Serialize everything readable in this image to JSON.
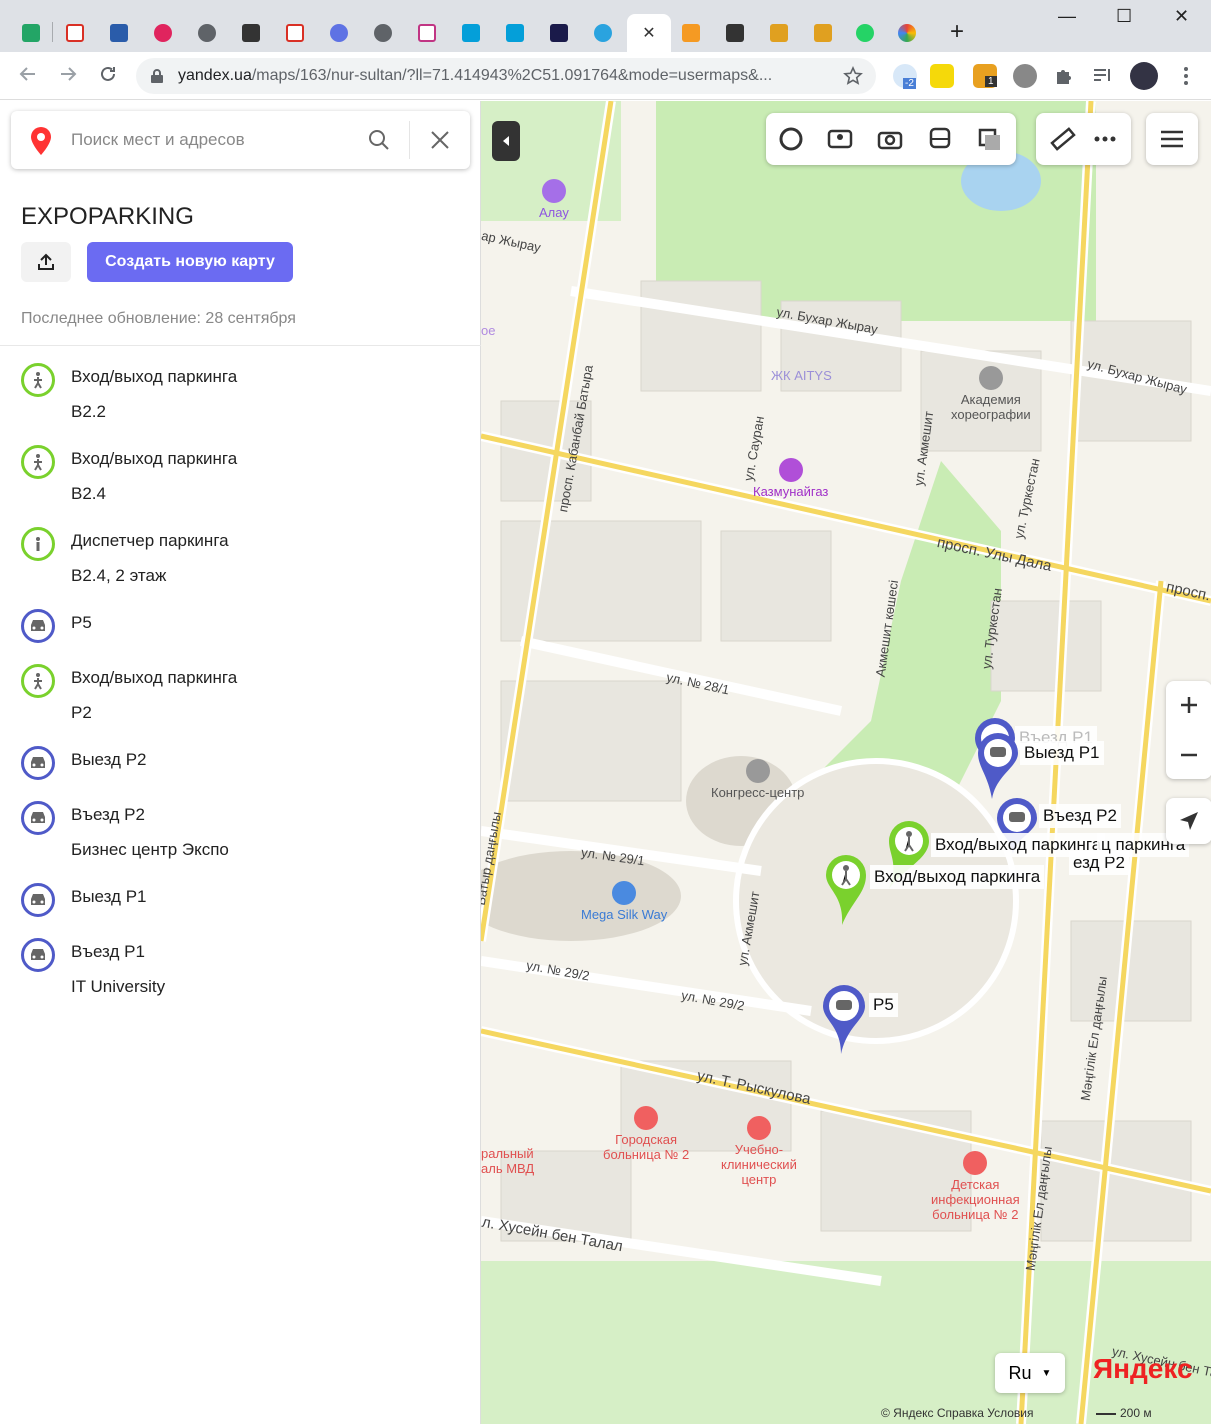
{
  "browser": {
    "url_host": "yandex.ua",
    "url_rest": "/maps/163/nur-sultan/?ll=71.414943%2C51.091764&mode=usermaps&...",
    "ext_badge_2": "-2",
    "ext_badge_1": "1",
    "new_tab": "+",
    "minimize": "—",
    "maximize": "☐",
    "close": "✕",
    "tab_close": "✕"
  },
  "sidebar": {
    "search_placeholder": "Поиск мест и адресов",
    "title": "EXPOPARKING",
    "create_label": "Создать новую карту",
    "updated": "Последнее обновление: 28 сентября",
    "items": [
      {
        "icon": "pedestrian-icon",
        "kind": "green",
        "line1": "Вход/выход паркинга",
        "line2": "B2.2"
      },
      {
        "icon": "pedestrian-icon",
        "kind": "green",
        "line1": "Вход/выход паркинга",
        "line2": "B2.4"
      },
      {
        "icon": "info-icon",
        "kind": "green",
        "line1": "Диспетчер паркинга",
        "line2": "B2.4, 2 этаж"
      },
      {
        "icon": "car-icon",
        "kind": "blue",
        "line1": "P5",
        "line2": ""
      },
      {
        "icon": "pedestrian-icon",
        "kind": "green",
        "line1": "Вход/выход паркинга",
        "line2": "P2"
      },
      {
        "icon": "car-icon",
        "kind": "blue",
        "line1": "Выезд P2",
        "line2": ""
      },
      {
        "icon": "car-icon",
        "kind": "blue",
        "line1": "Въезд P2",
        "line2": "Бизнес центр Экспо"
      },
      {
        "icon": "car-icon",
        "kind": "blue",
        "line1": "Выезд P1",
        "line2": ""
      },
      {
        "icon": "car-icon",
        "kind": "blue",
        "line1": "Въезд P1",
        "line2": "IT University"
      }
    ]
  },
  "map": {
    "streets": {
      "buhar1": "ул. Бухар Жырау",
      "buhar2": "ул. Бухар Жырау",
      "zhyrau": "ар Жырау",
      "kabanbai": "просп. Кабанбай Батыра",
      "sauran": "ул. Сауран",
      "akmeshit1": "ул. Акмешит",
      "akmeshit2": "ул. Акмешит",
      "akmeshit_k": "Акмешит көшесі",
      "turkestan1": "ул. Туркестан",
      "turkestan2": "ул. Туркестан",
      "uly_dala": "просп. Улы Дала",
      "prosp": "просп.",
      "s28": "ул. № 28/1",
      "s29_1": "ул. № 29/1",
      "s29_2a": "ул. № 29/2",
      "s29_2b": "ул. № 29/2",
      "ryskulov": "ул. Т. Рыскулова",
      "husein": "л. Хусейн бен Талал",
      "mangilik1": "Мәңгілік Ел даңғылы",
      "mangilik2": "Мәңгілік Ел даңғылы",
      "batyr": "Батыр даңғылы",
      "husein2": "ул. Хусейн бен Тала"
    },
    "pois": {
      "alau": "Алау",
      "aitys": "ЖК AITYS",
      "academy": "Академия\nхореографии",
      "kmg": "Казмунайгаз",
      "congress": "Конгресс-центр",
      "mega": "Mega Silk Way",
      "hosp2": "Городская\nбольница № 2",
      "clinic": "Учебно-\nклинический\nцентр",
      "child": "Детская\nинфекционная\nбольница № 2",
      "mvd": "ральный\nаль МВД",
      "oe": "ое"
    },
    "pins": {
      "exit_p1": "Выезд P1",
      "entry_p1": "Въезд P1",
      "entry_p2": "Въезд P2",
      "ped1": "Вход/выход паркинга",
      "ped1_tail": "ц паркинга",
      "ped2": "Вход/выход паркинга",
      "ped2_tail": "езд P2",
      "p5": "P5"
    },
    "lang": "Ru",
    "brand": "Яндекс",
    "footer": "© Яндекс   Справка   Условия",
    "scale": "200 м"
  }
}
